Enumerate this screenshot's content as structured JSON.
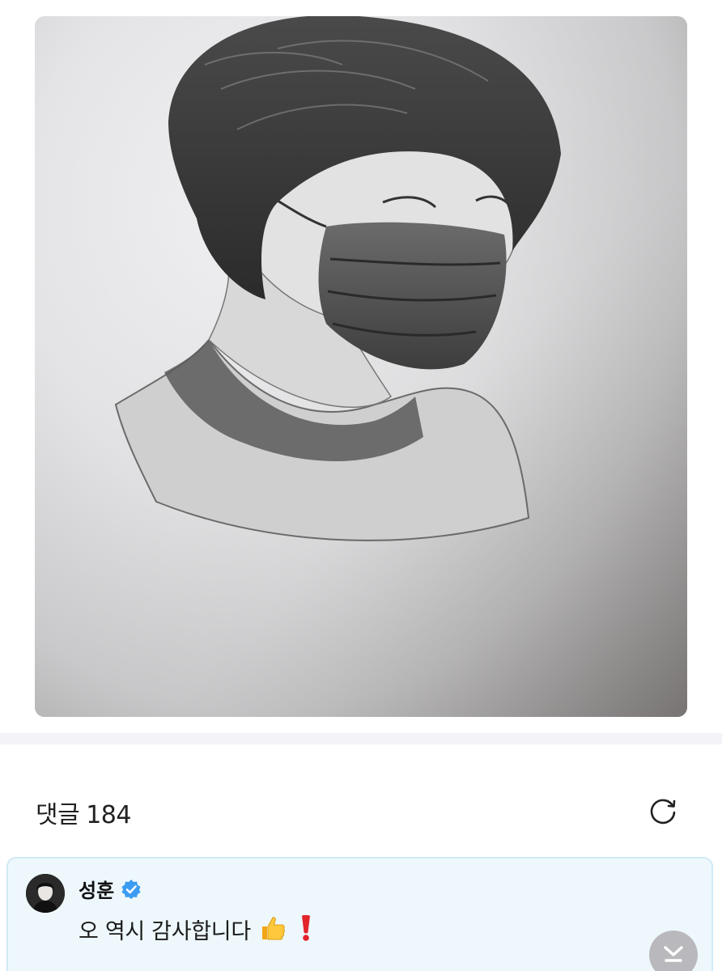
{
  "comments": {
    "title": "댓글",
    "count": "184"
  },
  "pinned_comment": {
    "author": "성훈",
    "verified": true,
    "text": "오 역시 감사합니다",
    "emojis": [
      "thumbs-up",
      "exclamation-mark"
    ]
  },
  "icons": {
    "refresh": "refresh-icon",
    "verified": "verified-badge-icon",
    "scroll_down": "arrow-down-to-line-icon"
  },
  "colors": {
    "verified_blue": "#3b9cf2",
    "comment_highlight_bg": "#eef8fc",
    "comment_highlight_border": "#cfe9f6",
    "divider": "#f4f4f8"
  }
}
